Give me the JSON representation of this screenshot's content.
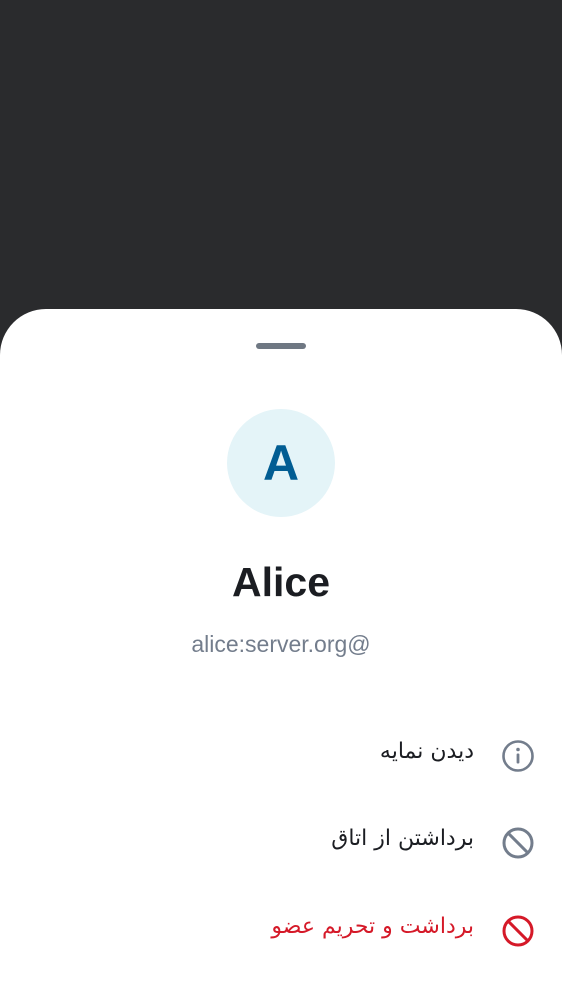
{
  "member": {
    "avatar_initial": "A",
    "display_name": "Alice",
    "user_id": "alice:server.org@"
  },
  "actions": [
    {
      "label": "دیدن نمایه",
      "icon": "info-icon"
    },
    {
      "label": "برداشتن از اتاق",
      "icon": "block-icon"
    },
    {
      "label": "برداشت و تحریم عضو",
      "icon": "ban-icon",
      "color": "#d51928"
    }
  ],
  "colors": {
    "backdrop": "#2a2b2d",
    "sheet": "#ffffff",
    "avatar_bg": "#e4f4f8",
    "avatar_text": "#015d93",
    "secondary_text": "#737d8c",
    "danger": "#d51928"
  }
}
